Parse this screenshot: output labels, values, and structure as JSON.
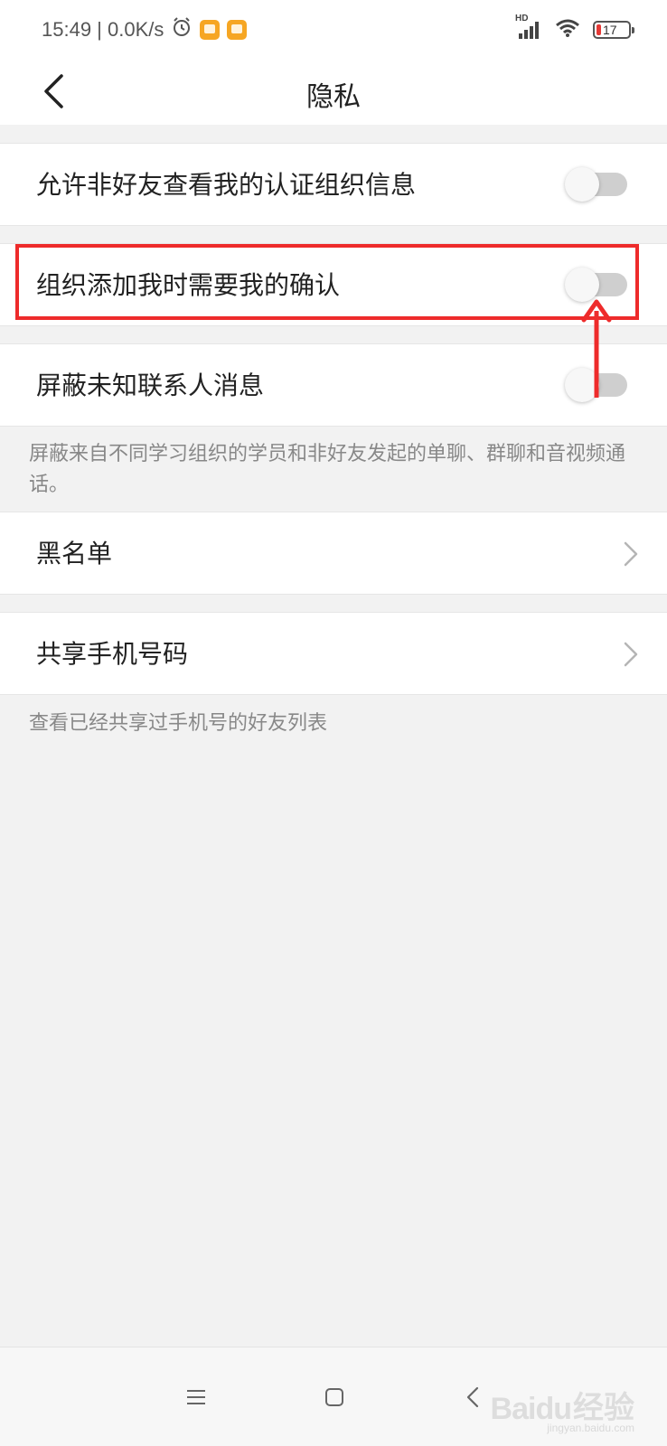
{
  "status_bar": {
    "time_speed": "15:49 | 0.0K/s",
    "network_label": "HD",
    "battery": "17"
  },
  "header": {
    "title": "隐私"
  },
  "settings": [
    {
      "label": "允许非好友查看我的认证组织信息",
      "enabled": false
    },
    {
      "label": "组织添加我时需要我的确认",
      "enabled": false,
      "highlighted": true
    },
    {
      "label": "屏蔽未知联系人消息",
      "enabled": false
    }
  ],
  "hints": {
    "block_unknown": "屏蔽来自不同学习组织的学员和非好友发起的单聊、群聊和音视频通话。",
    "shared_phone": "查看已经共享过手机号的好友列表"
  },
  "links": [
    {
      "label": "黑名单"
    },
    {
      "label": "共享手机号码"
    }
  ],
  "colors": {
    "annotation": "#ee2b2b",
    "toggle_off_track": "#cfcfcf"
  },
  "watermark": {
    "logo": "Baidu",
    "text": "经验",
    "url": "jingyan.baidu.com"
  }
}
